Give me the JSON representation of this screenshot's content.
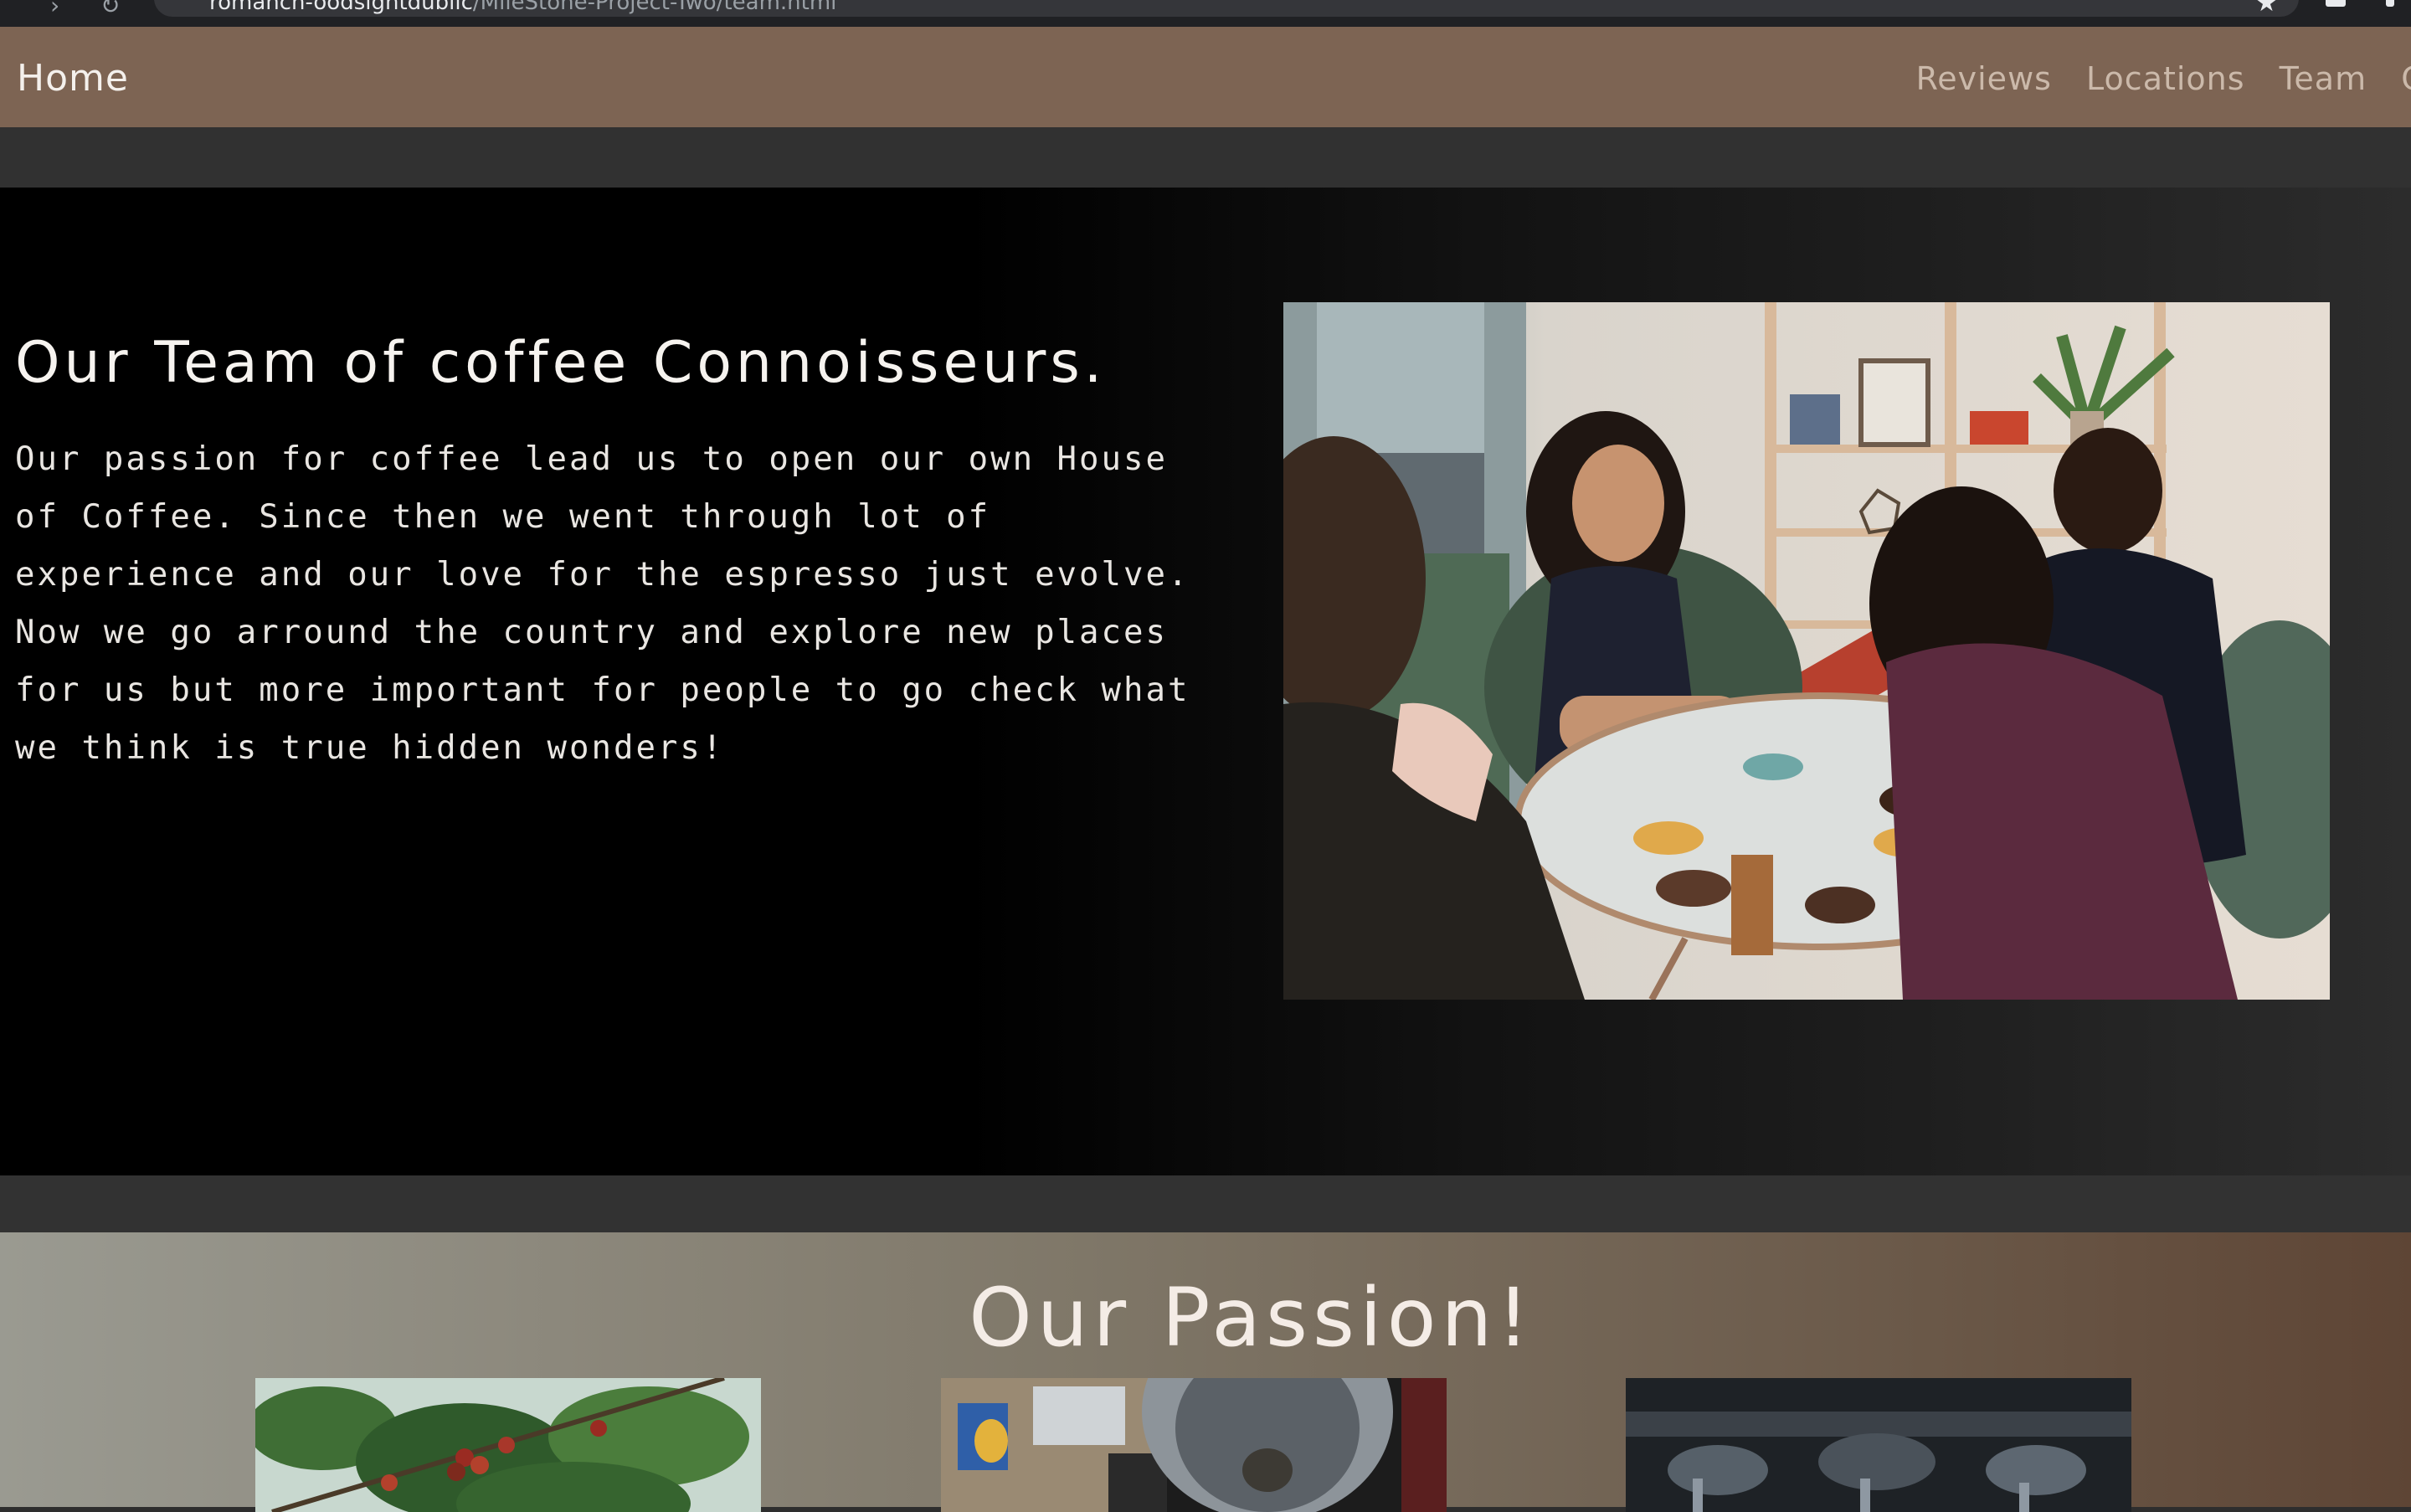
{
  "browser": {
    "url_host": "romanch-oodsightdublic",
    "url_path": "/MileStone-Project-Two/team.html"
  },
  "nav": {
    "home": "Home",
    "links": [
      "Reviews",
      "Locations",
      "Team",
      "Co"
    ]
  },
  "hero": {
    "title": "Our Team of coffee Connoisseurs.",
    "text": "Our passion for coffee lead us to open our own House of Coffee. Since then we went through lot of experience and our love for the espresso just evolve. Now we go arround the country and explore new places for us but more important for people to go check what we think is true hidden wonders!",
    "photo_alt": "team-photo"
  },
  "passion": {
    "title": "Our Passion!"
  },
  "colors": {
    "nav_bg": "#7d6453",
    "hero_bg": "#000000",
    "passion_bg_start": "#9a9a91",
    "passion_bg_end": "#5e4535"
  }
}
